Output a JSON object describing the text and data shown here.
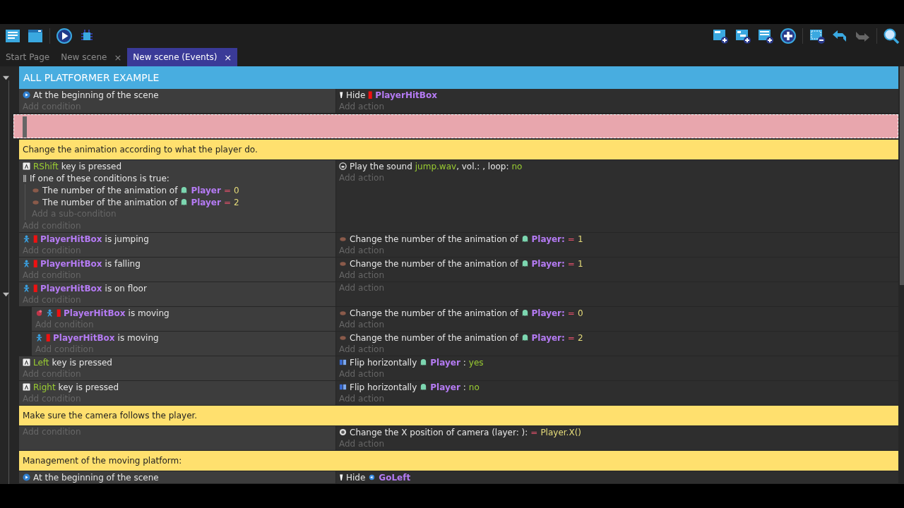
{
  "tabs": [
    {
      "label": "Start Page",
      "selected": false
    },
    {
      "label": "New scene",
      "close": "×",
      "selected": false
    },
    {
      "label": "New scene (Events)",
      "close": "×",
      "selected": true
    }
  ],
  "events": [
    {
      "kind": "group",
      "title": "ALL PLATFORMER EXAMPLE",
      "expanded": true,
      "children": [
        {
          "kind": "standard",
          "conditions": [
            {
              "kind": "scene-start",
              "inverted": false,
              "parts": [
                {
                  "kind": "text",
                  "text": "At the beginning of the scene"
                }
              ]
            }
          ],
          "add_condition": "Add condition",
          "actions": [
            {
              "kind": "hide",
              "parts": [
                {
                  "kind": "text",
                  "text": "Hide"
                },
                {
                  "kind": "box",
                  "text": "PlayerHitBox"
                }
              ]
            }
          ],
          "add_action": "Add action"
        },
        {
          "kind": "drop-zone"
        },
        {
          "kind": "comment",
          "text": "Change the animation according to what the player do."
        },
        {
          "kind": "standard",
          "conditions": [
            {
              "kind": "keyboard",
              "inverted": false,
              "parts": [
                {
                  "kind": "string",
                  "text": "RShift"
                },
                {
                  "kind": "text",
                  "text": "key is pressed"
                }
              ]
            },
            {
              "kind": "or",
              "inverted": false,
              "parts": [
                {
                  "kind": "text",
                  "text": "If one of these conditions is true:"
                }
              ],
              "sub": [
                {
                  "kind": "animation",
                  "inverted": false,
                  "parts": [
                    {
                      "kind": "text",
                      "text": "The number of the animation of"
                    },
                    {
                      "kind": "sprite",
                      "text": "Player"
                    },
                    {
                      "kind": "operator",
                      "text": "="
                    },
                    {
                      "kind": "number",
                      "text": "0"
                    }
                  ]
                },
                {
                  "kind": "animation",
                  "inverted": false,
                  "parts": [
                    {
                      "kind": "text",
                      "text": "The number of the animation of"
                    },
                    {
                      "kind": "sprite",
                      "text": "Player"
                    },
                    {
                      "kind": "operator",
                      "text": "="
                    },
                    {
                      "kind": "number",
                      "text": "2"
                    }
                  ]
                }
              ],
              "add_sub": "Add a sub-condition"
            }
          ],
          "add_condition": "Add condition",
          "actions": [
            {
              "kind": "sound",
              "parts": [
                {
                  "kind": "text",
                  "text": "Play the sound"
                },
                {
                  "kind": "string",
                  "text": "jump.wav"
                },
                {
                  "kind": "suffix",
                  "text": ", vol.: , loop:"
                },
                {
                  "kind": "string",
                  "text": "no"
                }
              ]
            }
          ],
          "add_action": "Add action"
        },
        {
          "kind": "standard",
          "conditions": [
            {
              "kind": "platformer",
              "inverted": false,
              "parts": [
                {
                  "kind": "box",
                  "text": "PlayerHitBox"
                },
                {
                  "kind": "text",
                  "text": "is jumping"
                }
              ]
            }
          ],
          "add_condition": "Add condition",
          "actions": [
            {
              "kind": "animation",
              "parts": [
                {
                  "kind": "text",
                  "text": "Change the number of the animation of"
                },
                {
                  "kind": "sprite",
                  "text": "Player:"
                },
                {
                  "kind": "operator",
                  "text": "="
                },
                {
                  "kind": "number",
                  "text": "1"
                }
              ]
            }
          ],
          "add_action": "Add action"
        },
        {
          "kind": "standard",
          "conditions": [
            {
              "kind": "platformer",
              "inverted": false,
              "parts": [
                {
                  "kind": "box",
                  "text": "PlayerHitBox"
                },
                {
                  "kind": "text",
                  "text": "is falling"
                }
              ]
            }
          ],
          "add_condition": "Add condition",
          "actions": [
            {
              "kind": "animation",
              "parts": [
                {
                  "kind": "text",
                  "text": "Change the number of the animation of"
                },
                {
                  "kind": "sprite",
                  "text": "Player:"
                },
                {
                  "kind": "operator",
                  "text": "="
                },
                {
                  "kind": "number",
                  "text": "1"
                }
              ]
            }
          ],
          "add_action": "Add action"
        },
        {
          "kind": "standard",
          "expanded": true,
          "conditions": [
            {
              "kind": "platformer",
              "inverted": false,
              "parts": [
                {
                  "kind": "box",
                  "text": "PlayerHitBox"
                },
                {
                  "kind": "text",
                  "text": "is on floor"
                }
              ]
            }
          ],
          "add_condition": "Add condition",
          "add_action": "Add action",
          "children": [
            {
              "kind": "standard",
              "conditions": [
                {
                  "kind": "platformer",
                  "inverted": true,
                  "parts": [
                    {
                      "kind": "box",
                      "text": "PlayerHitBox"
                    },
                    {
                      "kind": "text",
                      "text": "is moving"
                    }
                  ]
                }
              ],
              "add_condition": "Add condition",
              "actions": [
                {
                  "kind": "animation",
                  "parts": [
                    {
                      "kind": "text",
                      "text": "Change the number of the animation of"
                    },
                    {
                      "kind": "sprite",
                      "text": "Player:"
                    },
                    {
                      "kind": "operator",
                      "text": "="
                    },
                    {
                      "kind": "number",
                      "text": "0"
                    }
                  ]
                }
              ],
              "add_action": "Add action"
            },
            {
              "kind": "standard",
              "conditions": [
                {
                  "kind": "platformer",
                  "inverted": false,
                  "parts": [
                    {
                      "kind": "box",
                      "text": "PlayerHitBox"
                    },
                    {
                      "kind": "text",
                      "text": "is moving"
                    }
                  ]
                }
              ],
              "add_condition": "Add condition",
              "actions": [
                {
                  "kind": "animation",
                  "parts": [
                    {
                      "kind": "text",
                      "text": "Change the number of the animation of"
                    },
                    {
                      "kind": "sprite",
                      "text": "Player:"
                    },
                    {
                      "kind": "operator",
                      "text": "="
                    },
                    {
                      "kind": "number",
                      "text": "2"
                    }
                  ]
                }
              ],
              "add_action": "Add action"
            }
          ]
        },
        {
          "kind": "standard",
          "conditions": [
            {
              "kind": "keyboard",
              "inverted": false,
              "parts": [
                {
                  "kind": "string",
                  "text": "Left"
                },
                {
                  "kind": "text",
                  "text": "key is pressed"
                }
              ]
            }
          ],
          "add_condition": "Add condition",
          "actions": [
            {
              "kind": "flip",
              "parts": [
                {
                  "kind": "text",
                  "text": "Flip horizontally"
                },
                {
                  "kind": "sprite",
                  "text": "Player"
                },
                {
                  "kind": "text",
                  "text": ":"
                },
                {
                  "kind": "string",
                  "text": "yes"
                }
              ]
            }
          ],
          "add_action": "Add action"
        },
        {
          "kind": "standard",
          "conditions": [
            {
              "kind": "keyboard",
              "inverted": false,
              "parts": [
                {
                  "kind": "string",
                  "text": "Right"
                },
                {
                  "kind": "text",
                  "text": "key is pressed"
                }
              ]
            }
          ],
          "add_condition": "Add condition",
          "actions": [
            {
              "kind": "flip",
              "parts": [
                {
                  "kind": "text",
                  "text": "Flip horizontally"
                },
                {
                  "kind": "sprite",
                  "text": "Player"
                },
                {
                  "kind": "text",
                  "text": ":"
                },
                {
                  "kind": "string",
                  "text": "no"
                }
              ]
            }
          ],
          "add_action": "Add action"
        },
        {
          "kind": "comment",
          "text": "Make sure the camera follows the player."
        },
        {
          "kind": "standard",
          "add_condition": "Add condition",
          "actions": [
            {
              "kind": "camera",
              "parts": [
                {
                  "kind": "text",
                  "text": "Change the X position of camera  (layer: ):"
                },
                {
                  "kind": "operator",
                  "text": "="
                },
                {
                  "kind": "number",
                  "text": "Player.X()"
                }
              ]
            }
          ],
          "add_action": "Add action"
        },
        {
          "kind": "comment",
          "text": "Management of the moving platform:"
        },
        {
          "kind": "standard",
          "conditions": [
            {
              "kind": "scene-start",
              "inverted": false,
              "parts": [
                {
                  "kind": "text",
                  "text": "At the beginning of the scene"
                }
              ]
            }
          ],
          "actions": [
            {
              "kind": "hide",
              "parts": [
                {
                  "kind": "text",
                  "text": "Hide"
                },
                {
                  "kind": "marker",
                  "text": "GoLeft"
                }
              ]
            }
          ]
        }
      ]
    }
  ]
}
